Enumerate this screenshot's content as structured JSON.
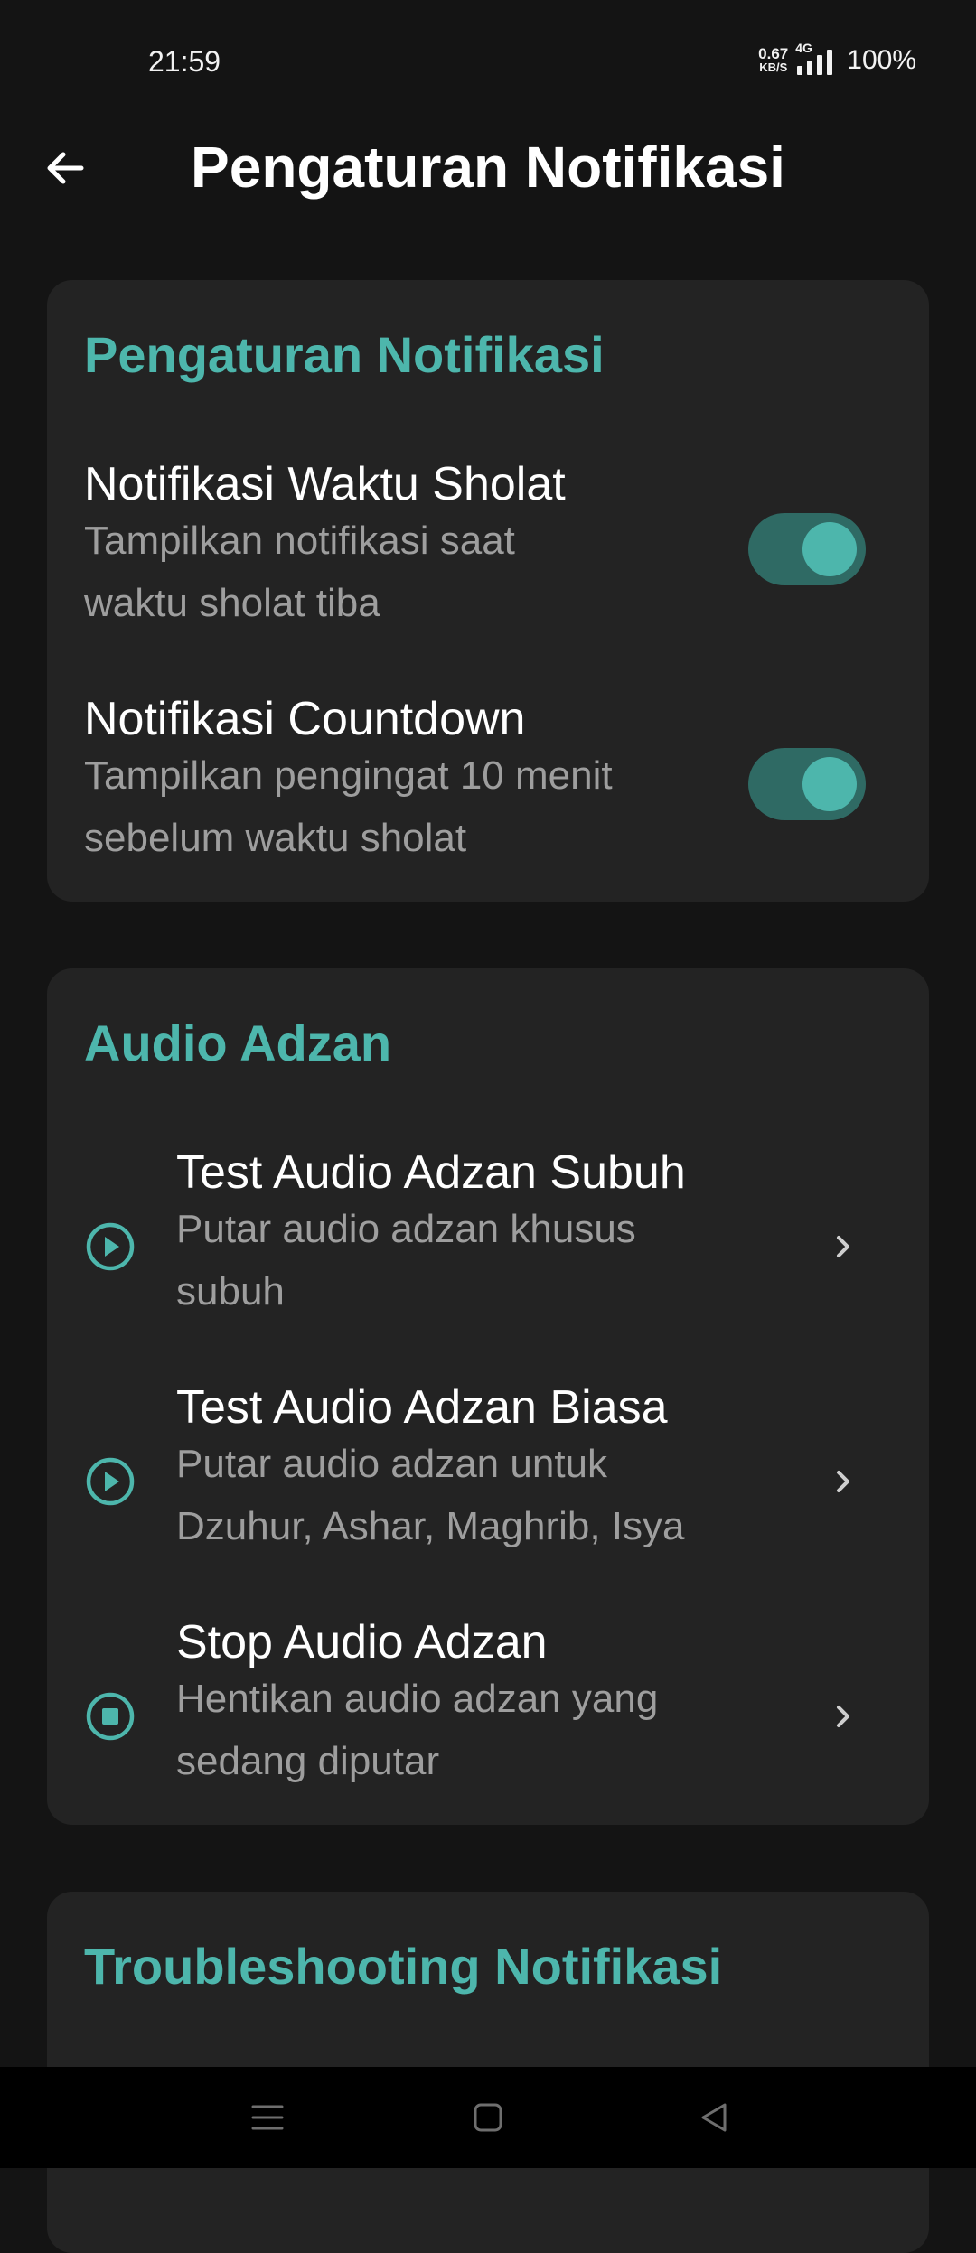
{
  "status_bar": {
    "time": "21:59",
    "net_speed_value": "0.67",
    "net_speed_unit": "KB/S",
    "network_type": "4G",
    "battery": "100%"
  },
  "app_bar": {
    "back_icon": "arrow-left-icon",
    "title": "Pengaturan Notifikasi"
  },
  "notification_settings": {
    "title": "Pengaturan Notifikasi",
    "items": [
      {
        "title": "Notifikasi Waktu Sholat",
        "subtitle_lines": [
          "Tampilkan notifikasi saat",
          "waktu sholat tiba"
        ],
        "enabled": true
      },
      {
        "title": "Notifikasi Countdown",
        "subtitle_lines": [
          "Tampilkan pengingat 10 menit",
          "sebelum waktu sholat"
        ],
        "enabled": true
      }
    ]
  },
  "audio_adzan": {
    "title": "Audio Adzan",
    "items": [
      {
        "icon": "play-circle-icon",
        "title": "Test Audio Adzan Subuh",
        "subtitle_lines": [
          "Putar audio adzan khusus",
          "subuh"
        ]
      },
      {
        "icon": "play-circle-icon",
        "title": "Test Audio Adzan Biasa",
        "subtitle_lines": [
          "Putar audio adzan untuk",
          "Dzuhur, Ashar, Maghrib, Isya"
        ]
      },
      {
        "icon": "stop-circle-icon",
        "title": "Stop Audio Adzan",
        "subtitle_lines": [
          "Hentikan audio adzan yang",
          "sedang diputar"
        ]
      }
    ]
  },
  "troubleshooting": {
    "title": "Troubleshooting Notifikasi"
  },
  "colors": {
    "accent": "#4db6ac",
    "background": "#141414",
    "card": "#232323",
    "subtitle": "#9e9e9e"
  }
}
